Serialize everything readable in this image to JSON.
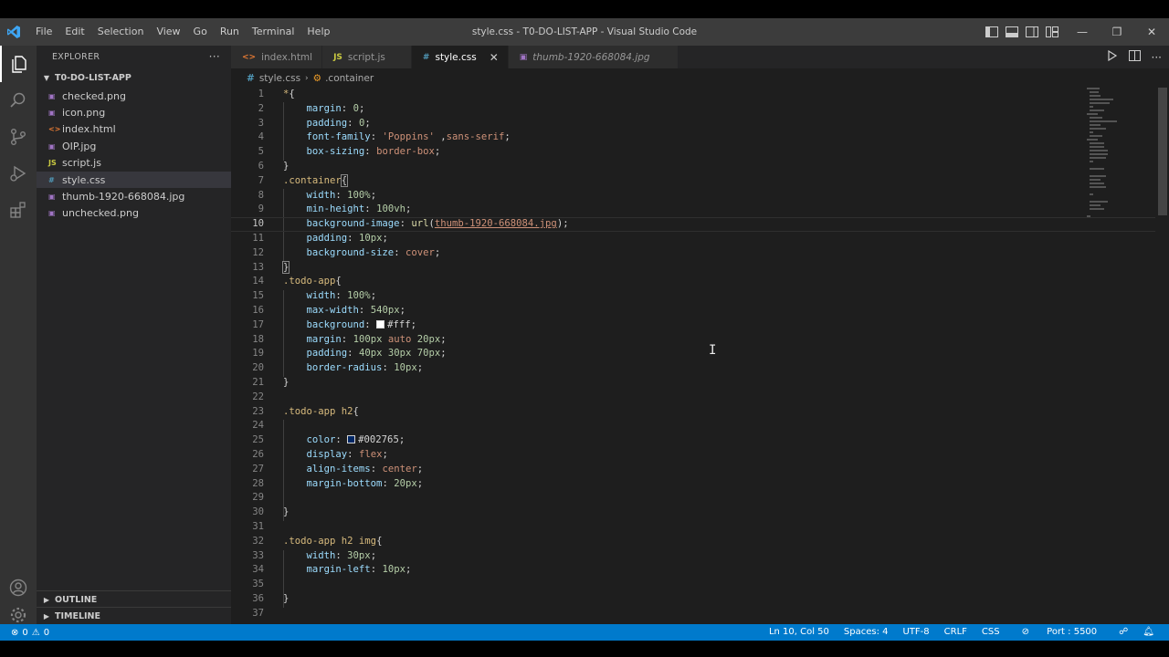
{
  "window": {
    "title": "style.css - T0-DO-LIST-APP - Visual Studio Code",
    "menu": [
      "File",
      "Edit",
      "Selection",
      "View",
      "Go",
      "Run",
      "Terminal",
      "Help"
    ],
    "controls": {
      "minimize": "—",
      "restore": "❐",
      "close": "✕"
    }
  },
  "sidebar": {
    "header": "EXPLORER",
    "more": "···",
    "folder": "T0-DO-LIST-APP",
    "files": [
      {
        "name": "checked.png",
        "icon": "image-file-icon",
        "glyph": "▣",
        "color": "#a074c4"
      },
      {
        "name": "icon.png",
        "icon": "image-file-icon",
        "glyph": "▣",
        "color": "#a074c4"
      },
      {
        "name": "index.html",
        "icon": "html-file-icon",
        "glyph": "<>",
        "color": "#e37933"
      },
      {
        "name": "OIP.jpg",
        "icon": "image-file-icon",
        "glyph": "▣",
        "color": "#a074c4"
      },
      {
        "name": "script.js",
        "icon": "js-file-icon",
        "glyph": "JS",
        "color": "#cbcb41"
      },
      {
        "name": "style.css",
        "icon": "css-file-icon",
        "glyph": "#",
        "color": "#519aba"
      },
      {
        "name": "thumb-1920-668084.jpg",
        "icon": "image-file-icon",
        "glyph": "▣",
        "color": "#a074c4"
      },
      {
        "name": "unchecked.png",
        "icon": "image-file-icon",
        "glyph": "▣",
        "color": "#a074c4"
      }
    ],
    "outline": "OUTLINE",
    "timeline": "TIMELINE"
  },
  "tabs": [
    {
      "label": "index.html",
      "glyph": "<>",
      "color": "#e37933",
      "active": false
    },
    {
      "label": "script.js",
      "glyph": "JS",
      "color": "#cbcb41",
      "active": false
    },
    {
      "label": "style.css",
      "glyph": "#",
      "color": "#519aba",
      "active": true,
      "close": "✕"
    },
    {
      "label": "thumb-1920-668084.jpg",
      "glyph": "▣",
      "color": "#a074c4",
      "active": false
    }
  ],
  "breadcrumb": {
    "file": "style.css",
    "symbol": ".container"
  },
  "editor": {
    "current_line": 10,
    "line_numbers": [
      "1",
      "2",
      "3",
      "4",
      "5",
      "6",
      "7",
      "8",
      "9",
      "10",
      "11",
      "12",
      "13",
      "14",
      "15",
      "16",
      "17",
      "18",
      "19",
      "20",
      "21",
      "22",
      "23",
      "24",
      "25",
      "26",
      "27",
      "28",
      "29",
      "30",
      "31",
      "32",
      "33",
      "34",
      "35",
      "36",
      "37"
    ]
  },
  "statusbar": {
    "errors": "0",
    "warnings": "0",
    "position": "Ln 10, Col 50",
    "spaces": "Spaces: 4",
    "encoding": "UTF-8",
    "eol": "CRLF",
    "language": "CSS",
    "port": "Port : 5500"
  },
  "colors": {
    "accent": "#007acc",
    "swatch_white": "#ffffff",
    "swatch_blue": "#002765"
  }
}
